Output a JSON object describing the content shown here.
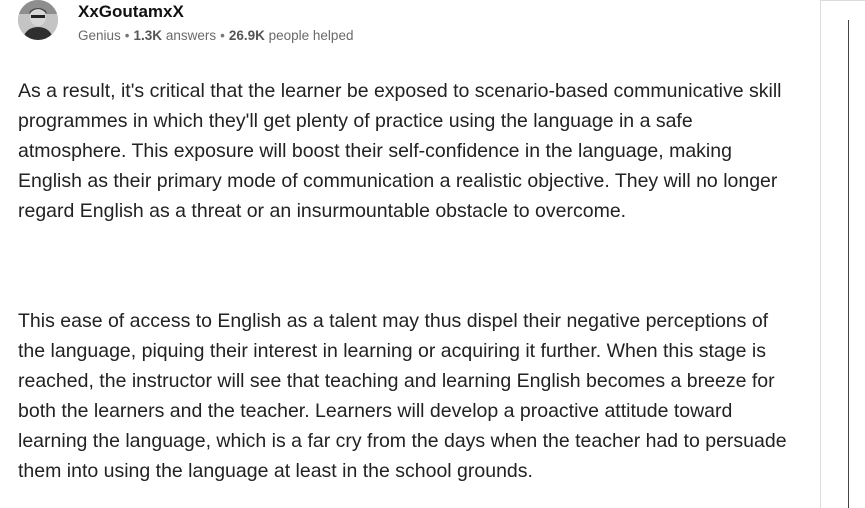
{
  "author": {
    "name": "XxGoutamxX",
    "rank": "Genius",
    "answers_count": "1.3K",
    "answers_label": "answers",
    "helped_count": "26.9K",
    "helped_label": "people helped",
    "separator": "•"
  },
  "answer": {
    "paragraphs": [
      "As a result, it's critical that the learner be exposed to scenario-based communicative skill programmes in which they'll get plenty of practice using the language in a safe atmosphere. This exposure will boost their self-confidence in the language, making English as their primary mode of communication a realistic objective. They will no longer regard English as a threat or an insurmountable obstacle to overcome.",
      "This ease of access to English as a talent may thus dispel their negative perceptions of the language, piquing their interest in learning or acquiring it further. When this stage is reached, the instructor will see that teaching and learning English becomes a breeze for both the learners and the teacher. Learners will develop a proactive attitude toward learning the language, which is a far cry from the days when the teacher had to persuade them into using the language at least in the school grounds."
    ]
  }
}
